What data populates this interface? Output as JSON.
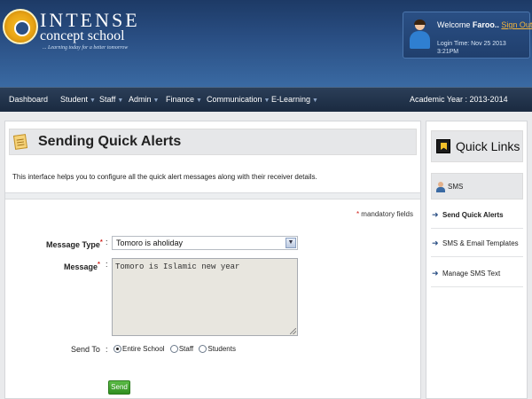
{
  "header": {
    "logo": {
      "title": "INTENSE",
      "subtitle": "concept school",
      "tagline": "... Learning today for a better tomorrow"
    },
    "user": {
      "welcome_prefix": "Welcome",
      "user_name": "Faroo..",
      "sign_out": "Sign Out",
      "login_time": "Login Time: Nov 25 2013 3:21PM"
    }
  },
  "nav": {
    "items": [
      {
        "label": "Dashboard",
        "caret": ""
      },
      {
        "label": "Student",
        "caret": "▼"
      },
      {
        "label": "Staff",
        "caret": "▼"
      },
      {
        "label": "Admin",
        "caret": "▼"
      },
      {
        "label": "Finance",
        "caret": "▼"
      },
      {
        "label": "Communication",
        "caret": "▼"
      },
      {
        "label": "E-Learning",
        "caret": "▼"
      }
    ],
    "academic_year": "Academic Year : 2013-2014"
  },
  "main": {
    "title": "Sending Quick Alerts",
    "title_icon": "notepad-icon",
    "intro": "This interface helps you to configure all the quick alert messages along with their receiver details.",
    "mandatory_star": "*",
    "mandatory_text": "mandatory fields",
    "form": {
      "message_type_label": "Message Type",
      "message_type_value": "Tomoro is aholiday",
      "message_label": "Message",
      "message_value": "Tomoro is Islamic new year",
      "send_to_label": "Send To",
      "colon": ":",
      "required_star": "*",
      "options": [
        {
          "label": "Entire School",
          "selected": true
        },
        {
          "label": "Staff",
          "selected": false
        },
        {
          "label": "Students",
          "selected": false
        }
      ],
      "send_button": "Send"
    }
  },
  "quick_links": {
    "title": "Quick Links",
    "section": "SMS",
    "links": [
      {
        "label": "Send Quick Alerts",
        "active": true
      },
      {
        "label": "SMS & Email Templates",
        "active": false
      },
      {
        "label": "Manage SMS Text",
        "active": false
      }
    ]
  },
  "colors": {
    "header_blue": "#2a4f84",
    "nav_dark": "#1a2a40",
    "sign_out": "#f5b63b",
    "send_green": "#2f8e1f",
    "required_red": "#d0201a"
  }
}
